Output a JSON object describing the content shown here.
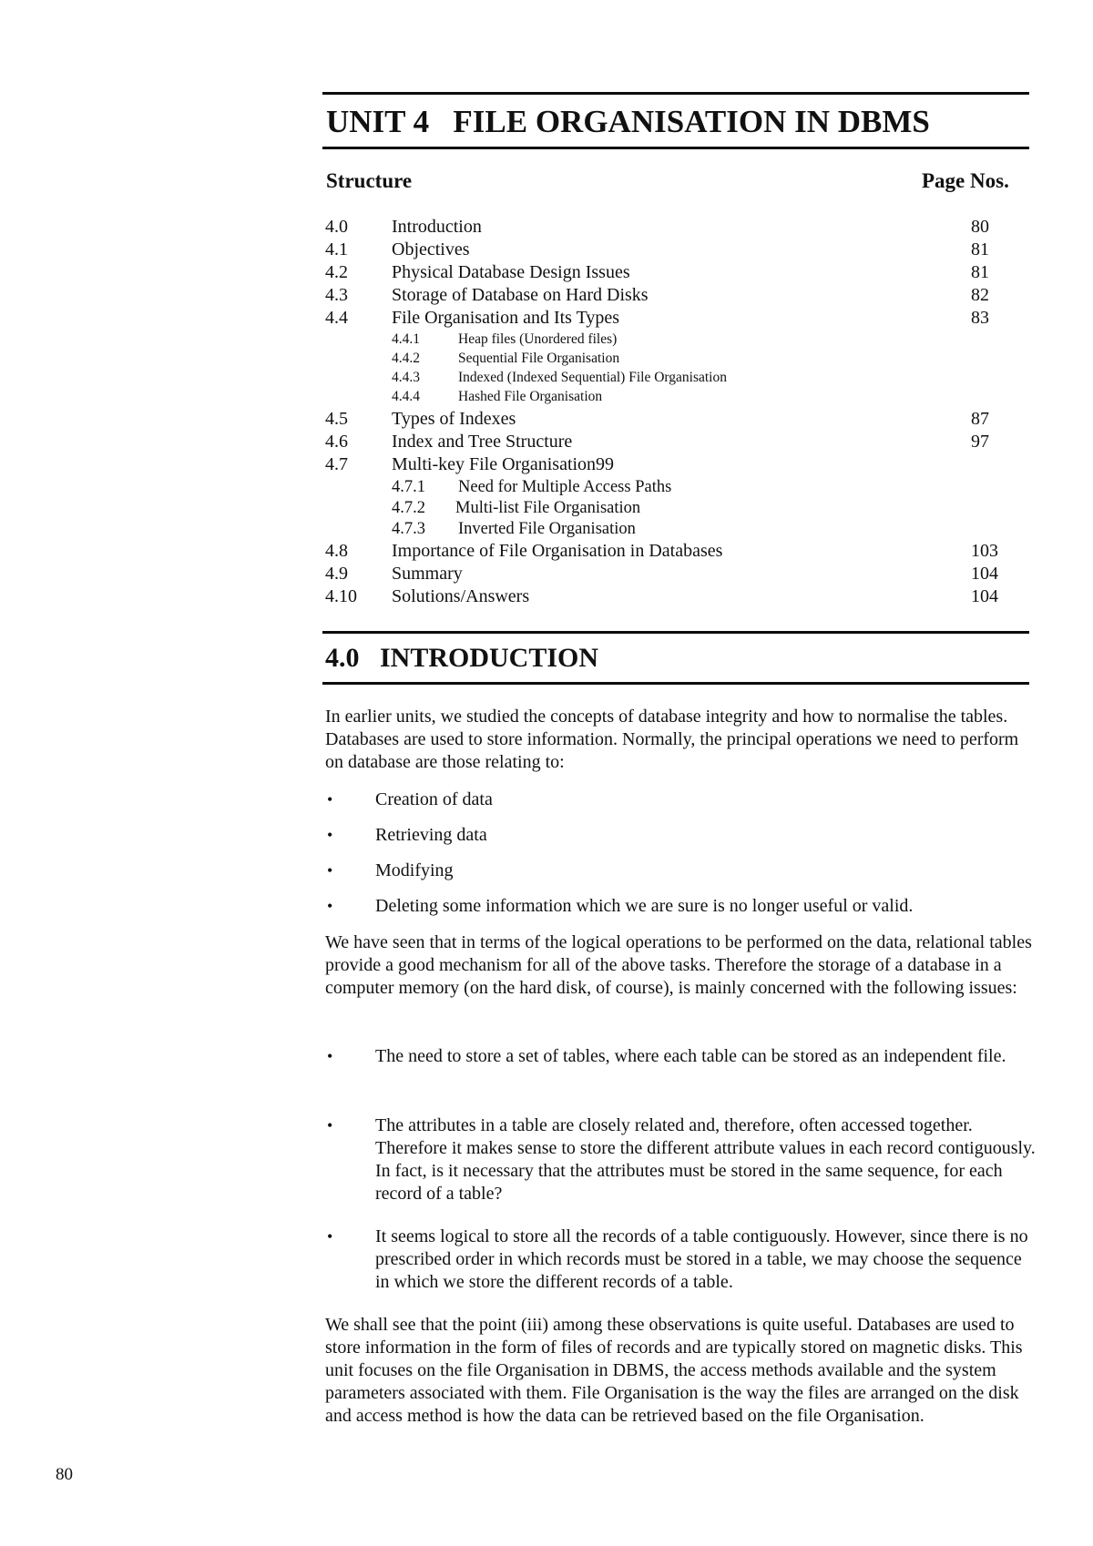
{
  "header": {
    "unit_label": "UNIT 4",
    "unit_title": "FILE ORGANISATION IN DBMS",
    "structure_label": "Structure",
    "page_nos_label": "Page Nos."
  },
  "toc": [
    {
      "num": "4.0",
      "title": "Introduction",
      "page": "80",
      "level": 1
    },
    {
      "num": "4.1",
      "title": "Objectives",
      "page": "81",
      "level": 1
    },
    {
      "num": "4.2",
      "title": "Physical Database Design Issues",
      "page": "81",
      "level": 1
    },
    {
      "num": "4.3",
      "title": "Storage of Database on Hard Disks",
      "page": "82",
      "level": 1
    },
    {
      "num": "4.4",
      "title": "File Organisation and Its Types",
      "page": "83",
      "level": 1
    },
    {
      "num": "4.4.1",
      "title": "Heap files (Unordered files)",
      "page": "",
      "level": 2
    },
    {
      "num": "4.4.2",
      "title": "Sequential File Organisation",
      "page": "",
      "level": 2
    },
    {
      "num": "4.4.3",
      "title": "Indexed (Indexed Sequential) File Organisation",
      "page": "",
      "level": 2
    },
    {
      "num": "4.4.4",
      "title": "Hashed File Organisation",
      "page": "",
      "level": 2
    },
    {
      "num": "4.5",
      "title": "Types of Indexes",
      "page": "87",
      "level": 1
    },
    {
      "num": "4.6",
      "title": "Index and Tree Structure",
      "page": "97",
      "level": 1
    },
    {
      "num": "4.7",
      "title": "Multi-key File Organisation99",
      "page": "",
      "level": 1
    },
    {
      "num": "4.7.1",
      "title": "Need for Multiple Access Paths",
      "page": "",
      "level": 3
    },
    {
      "num": "4.7.2",
      "title": "Multi-list File Organisation",
      "page": "",
      "level": 3
    },
    {
      "num": "4.7.3",
      "title": "Inverted File Organisation",
      "page": "",
      "level": 3
    },
    {
      "num": "4.8",
      "title": "Importance of File Organisation in Databases",
      "page": "103",
      "level": 1
    },
    {
      "num": "4.9",
      "title": "Summary",
      "page": "104",
      "level": 1
    },
    {
      "num": "4.10",
      "title": "Solutions/Answers",
      "page": "104",
      "level": 1
    }
  ],
  "introduction": {
    "heading_num": "4.0",
    "heading_title": "INTRODUCTION",
    "para1": "In earlier units, we studied the concepts of database integrity and how to normalise the tables. Databases are used to store information. Normally, the principal operations we need to perform on database are those relating to:",
    "operations": [
      "Creation of data",
      "Retrieving data",
      "Modifying",
      "Deleting some information which we are sure is no longer useful or valid."
    ],
    "para2": "We have seen that in terms of the logical operations to be performed on the data, relational tables provide a good mechanism for all of the above tasks. Therefore the storage of a database in a computer memory (on the hard disk, of course), is mainly concerned with the following issues:",
    "issues": [
      "The need to store a set of tables, where each table can be stored as an independent file.",
      "The attributes in a table are closely related and, therefore, often accessed together. Therefore it makes sense to store the different attribute values in each record contiguously. In fact, is it necessary that the attributes must be stored in the same sequence, for each record of a table?",
      "It seems logical to store all the records of a table contiguously. However, since there is no prescribed order in which records must be stored in a table, we may choose the sequence in which we store the different records of a table."
    ],
    "para3": "We shall see that the point (iii) among these observations is quite useful. Databases are used to store information in the form of files of records and are typically stored on magnetic disks. This unit focuses on the file Organisation in DBMS, the access methods available and the system parameters associated with them. File Organisation is the way the files are arranged on the disk and access method is how the data can be retrieved based on the file Organisation."
  },
  "bullet_glyph": "•",
  "footer": {
    "page_number": "80"
  }
}
